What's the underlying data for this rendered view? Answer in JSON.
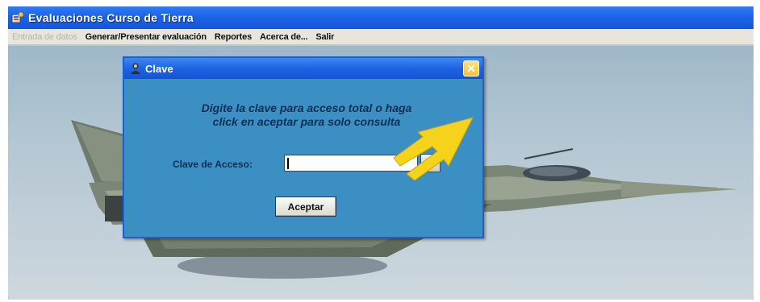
{
  "app": {
    "title": "Evaluaciones Curso de Tierra",
    "icon": "app-window-icon"
  },
  "menu": {
    "items": [
      {
        "label": "Entrada de datos",
        "enabled": false
      },
      {
        "label": "Generar/Presentar evaluación",
        "enabled": true
      },
      {
        "label": "Reportes",
        "enabled": true
      },
      {
        "label": "Acerca de...",
        "enabled": true
      },
      {
        "label": "Salir",
        "enabled": true
      }
    ]
  },
  "dialog": {
    "title": "Clave",
    "icon": "user-lock-icon",
    "prompt_line1": "Digite la clave para acceso total o haga",
    "prompt_line2": "click en aceptar para solo consulta",
    "field_label": "Clave de Acceso:",
    "field_value": "",
    "field_placeholder": "",
    "key_button_icon": "key-icon",
    "accept_label": "Aceptar",
    "close_icon": "close-icon"
  },
  "colors": {
    "titlebar": "#1d63e6",
    "dialog_background": "#3a8fc2",
    "prompt_text": "#0e2f55",
    "menubar": "#e8e6dc",
    "arrow": "#f5d21c"
  }
}
